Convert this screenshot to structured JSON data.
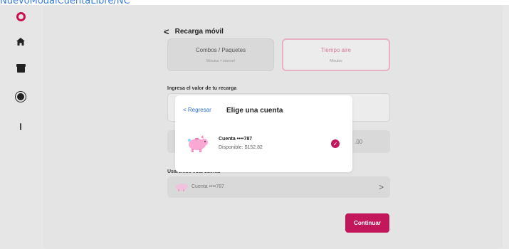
{
  "caption": "NuevoModalCuentaLibre/NC",
  "sidebar": {
    "icons": [
      "logo-icon",
      "home-icon",
      "store-icon",
      "settings-icon",
      "more-icon"
    ]
  },
  "header": {
    "back_glyph": "<",
    "title": "Recarga móvil"
  },
  "options": [
    {
      "title": "Combos / Paquetes",
      "subtitle": "Minutos + internet",
      "selected": false
    },
    {
      "title": "Tiempo aire",
      "subtitle": "Minutos",
      "selected": true
    }
  ],
  "form": {
    "amount_label": "Ingresa el valor de tu recarga",
    "amount_suffix": ".00"
  },
  "account": {
    "label": "Usaremos esta cuenta",
    "name": "Cuenta ••••787",
    "chevron": ">"
  },
  "continue_label": "Continuar",
  "modal": {
    "back_label": "< Regresar",
    "title": "Elige una cuenta",
    "account_name": "Cuenta ••••787",
    "account_available": "Disponible: $152.82",
    "check_glyph": "✓"
  },
  "colors": {
    "brand": "#c2185b",
    "link": "#2f6fd6",
    "pig": "#f9a8d4"
  }
}
